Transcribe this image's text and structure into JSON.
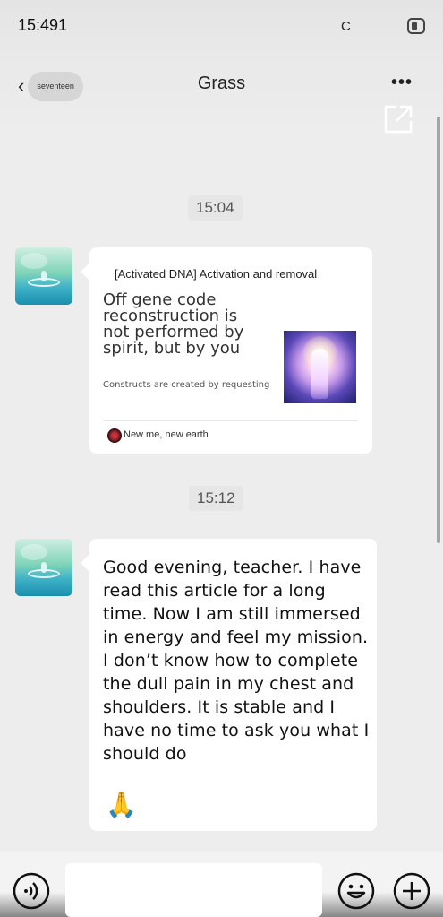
{
  "status_bar": {
    "time": "15:491",
    "carrier": "C",
    "battery_icon": "battery-icon"
  },
  "header": {
    "back_label": "seventeen",
    "back_icon": "chevron-left-icon",
    "title": "Grass",
    "more_icon": "more-dots-icon",
    "share_icon": "share-external-icon"
  },
  "messages": [
    {
      "timestamp": "15:04",
      "type": "article-card",
      "card": {
        "title": "[Activated DNA] Activation and removal",
        "description": "Off gene code reconstruction is not performed by spirit, but by you",
        "subtitle": "Constructs are created by requesting",
        "source": "New me, new earth"
      }
    },
    {
      "timestamp": "15:12",
      "type": "text",
      "text": "Good evening, teacher. I have read this article for a long time. Now I am still immersed in energy and feel my mission. I don’t know how to complete the dull pain in my chest and shoulders. It is stable and I have no time to ask you what I should do",
      "emoji": "🙏"
    }
  ],
  "input_bar": {
    "voice_icon": "voice-icon",
    "emoji_icon": "smiley-icon",
    "plus_icon": "plus-icon",
    "input_value": ""
  },
  "colors": {
    "background": "#ededed",
    "bubble": "#ffffff",
    "timestamp_bg": "#e6e6e6"
  }
}
